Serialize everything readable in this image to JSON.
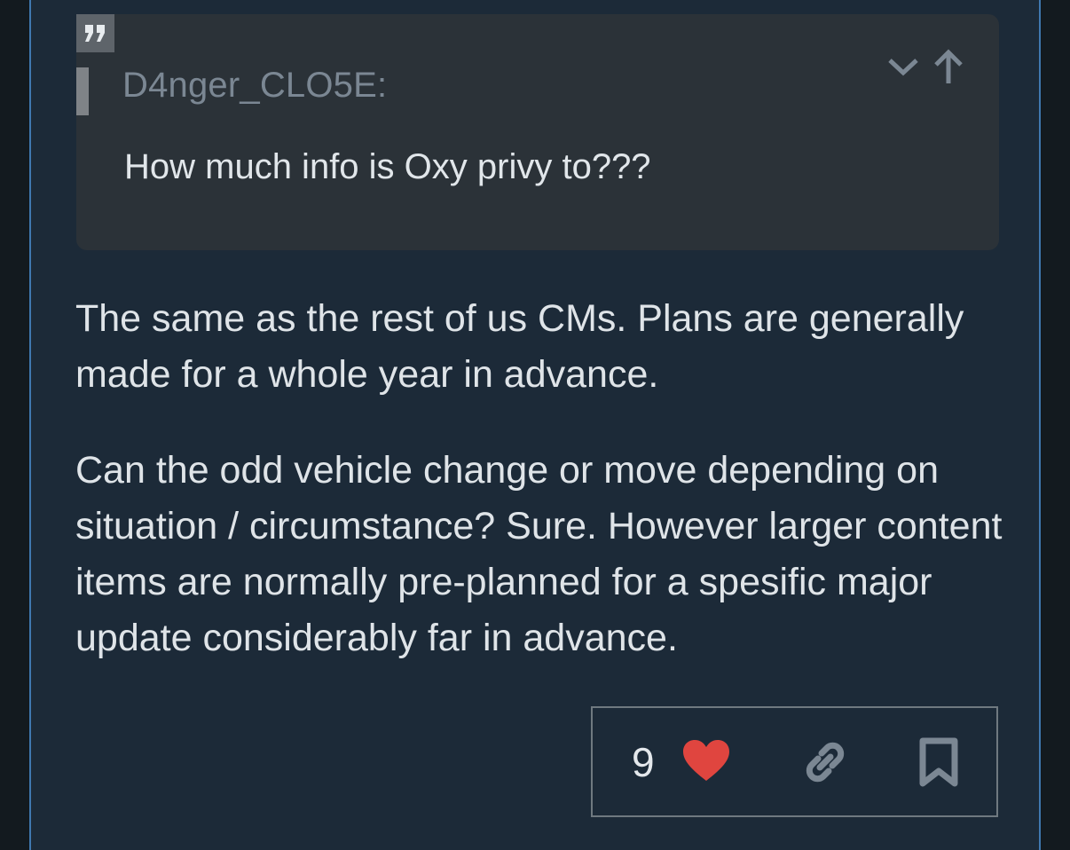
{
  "quote": {
    "author": "D4nger_CLO5E:",
    "text": "How much info is Oxy privy to???"
  },
  "reply": {
    "paragraphs": [
      "The same as the rest of us CMs. Plans are generally made for a whole year in advance.",
      "Can the odd vehicle change or move depending on situation / circumstance? Sure. However larger content items are normally pre-planned for a spesific major update considerably far in advance."
    ]
  },
  "actions": {
    "like_count": "9",
    "icons": [
      "heart-icon",
      "link-icon",
      "bookmark-icon"
    ]
  },
  "colors": {
    "background": "#131a1f",
    "post_background": "#1c2a38",
    "accent_border": "#3f78b0",
    "quote_background": "#2b3238",
    "heart": "#e0453f"
  }
}
